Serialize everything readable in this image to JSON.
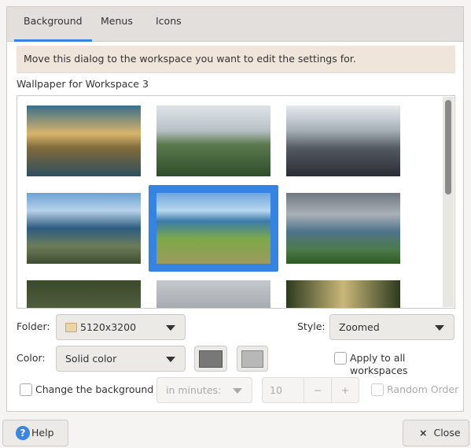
{
  "tabs": [
    {
      "label": "Background",
      "active": true
    },
    {
      "label": "Menus"
    },
    {
      "label": "Icons"
    }
  ],
  "notice": "Move this dialog to the workspace you want to edit the settings for.",
  "wallpaper_label": "Wallpaper for Workspace 3",
  "selected_index": 4,
  "folder": {
    "label": "Folder:",
    "value": "5120x3200",
    "icon": "folder-icon"
  },
  "style": {
    "label": "Style:",
    "value": "Zoomed"
  },
  "color": {
    "label": "Color:",
    "value": "Solid color",
    "primary": "#787878",
    "secondary": "#b8b8b8"
  },
  "apply_all": {
    "label": "Apply to all workspaces",
    "checked": false
  },
  "change_bg": {
    "label": "Change the background",
    "checked": false,
    "interval": "in minutes:",
    "value": "10",
    "minus": "−",
    "plus": "+"
  },
  "random_order": {
    "label": "Random Order",
    "checked": false
  },
  "help": "Help",
  "close": "Close",
  "close_icon": "×",
  "accent": "#3584e4"
}
